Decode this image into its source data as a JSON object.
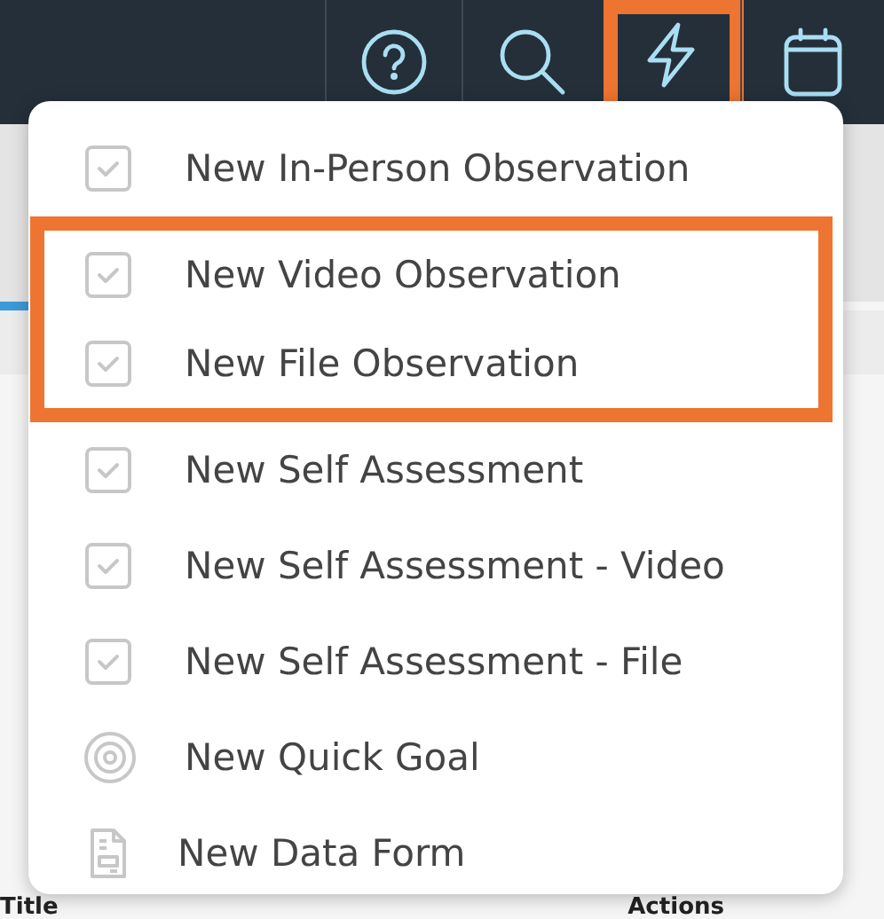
{
  "toolbar": {
    "buttons": [
      {
        "kind": "help",
        "highlighted": false
      },
      {
        "kind": "search",
        "highlighted": false
      },
      {
        "kind": "lightning",
        "highlighted": true
      },
      {
        "kind": "calendar",
        "highlighted": false
      }
    ]
  },
  "menu": {
    "items": [
      {
        "kind": "checkbox",
        "label": "New In-Person Observation",
        "highlighted": false
      },
      {
        "kind": "checkbox",
        "label": "New Video Observation",
        "highlighted": true
      },
      {
        "kind": "checkbox",
        "label": "New File Observation",
        "highlighted": true
      },
      {
        "kind": "checkbox",
        "label": "New Self Assessment",
        "highlighted": false
      },
      {
        "kind": "checkbox",
        "label": "New Self Assessment - Video",
        "highlighted": false
      },
      {
        "kind": "checkbox",
        "label": "New Self Assessment - File",
        "highlighted": false
      },
      {
        "kind": "goal",
        "label": "New Quick Goal",
        "highlighted": false
      },
      {
        "kind": "form",
        "label": "New Data Form",
        "highlighted": false
      }
    ]
  },
  "table": {
    "columns": [
      {
        "label": "Title"
      },
      {
        "label": "Actions"
      }
    ]
  }
}
